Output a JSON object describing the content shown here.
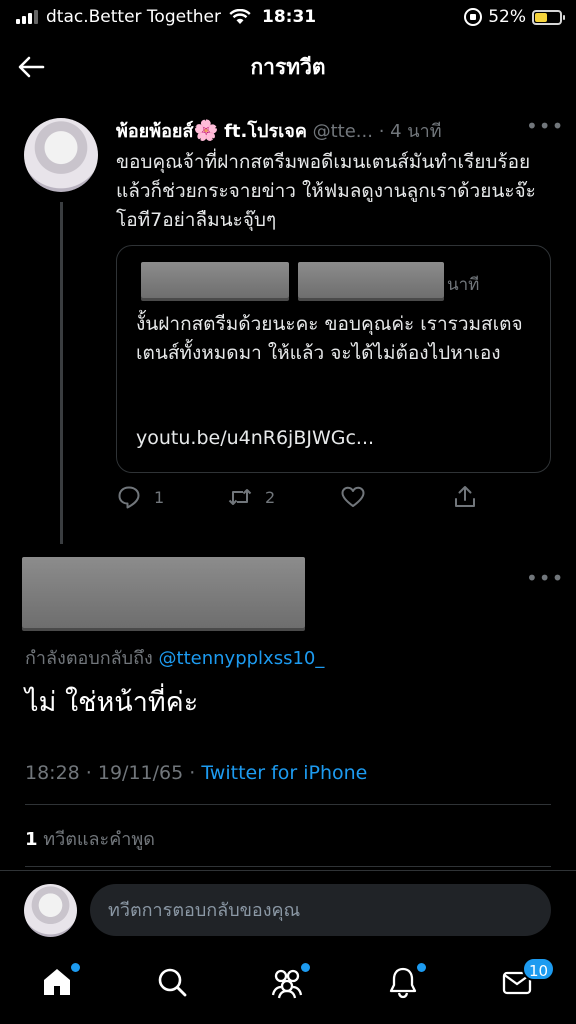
{
  "status_bar": {
    "carrier": "dtac.Better Together",
    "time": "18:31",
    "battery_percent": "52%",
    "battery_level": 0.52
  },
  "header": {
    "title": "การทวีต",
    "back_icon": "back-arrow-icon"
  },
  "context_tweet": {
    "author_name": "พ้อยพ้อยส์",
    "author_suffix": "ft.โปรเจค",
    "handle": "@tte...",
    "time_ago": "· 4 นาที",
    "text": "ขอบคุณจ้าที่ฝากสตรีมพอดีเมนเตนส์มันทำเรียบร้อยแล้วก็ช่วยกระจายข่าว ให้ฟมลดูงานลูกเราด้วยนะจ๊ะโอที7อย่าลืมนะจุ๊บๆ",
    "quoted": {
      "time_ago": "นาที",
      "text": "งั้นฝากสตรีมด้วยนะคะ ขอบคุณค่ะ เรารวมสเตจเตนส์ทั้งหมดมา ให้แล้ว จะได้ไม่ต้องไปหาเอง",
      "link": "youtu.be/u4nR6jBJWGc..."
    },
    "reply_count": "1",
    "retweet_count": "2"
  },
  "main_tweet": {
    "replying_prefix": "กำลังตอบกลับถึง",
    "replying_to": "@ttennypplxss10_",
    "text": "ไม่ ใช่หน้าที่ค่ะ",
    "timestamp": "18:28 · 19/11/65 ·",
    "source": "Twitter for iPhone",
    "quote_count": "1",
    "quote_label": "ทวีตและคำพูด"
  },
  "composer": {
    "placeholder": "ทวีตการตอบกลับของคุณ"
  },
  "tabbar": {
    "items": [
      "home-icon",
      "search-icon",
      "communities-icon",
      "notifications-icon",
      "messages-icon"
    ],
    "messages_badge": "10"
  },
  "colors": {
    "background": "#000000",
    "accent": "#1d9bf0",
    "muted": "#71767b",
    "text": "#e7e9ea"
  }
}
